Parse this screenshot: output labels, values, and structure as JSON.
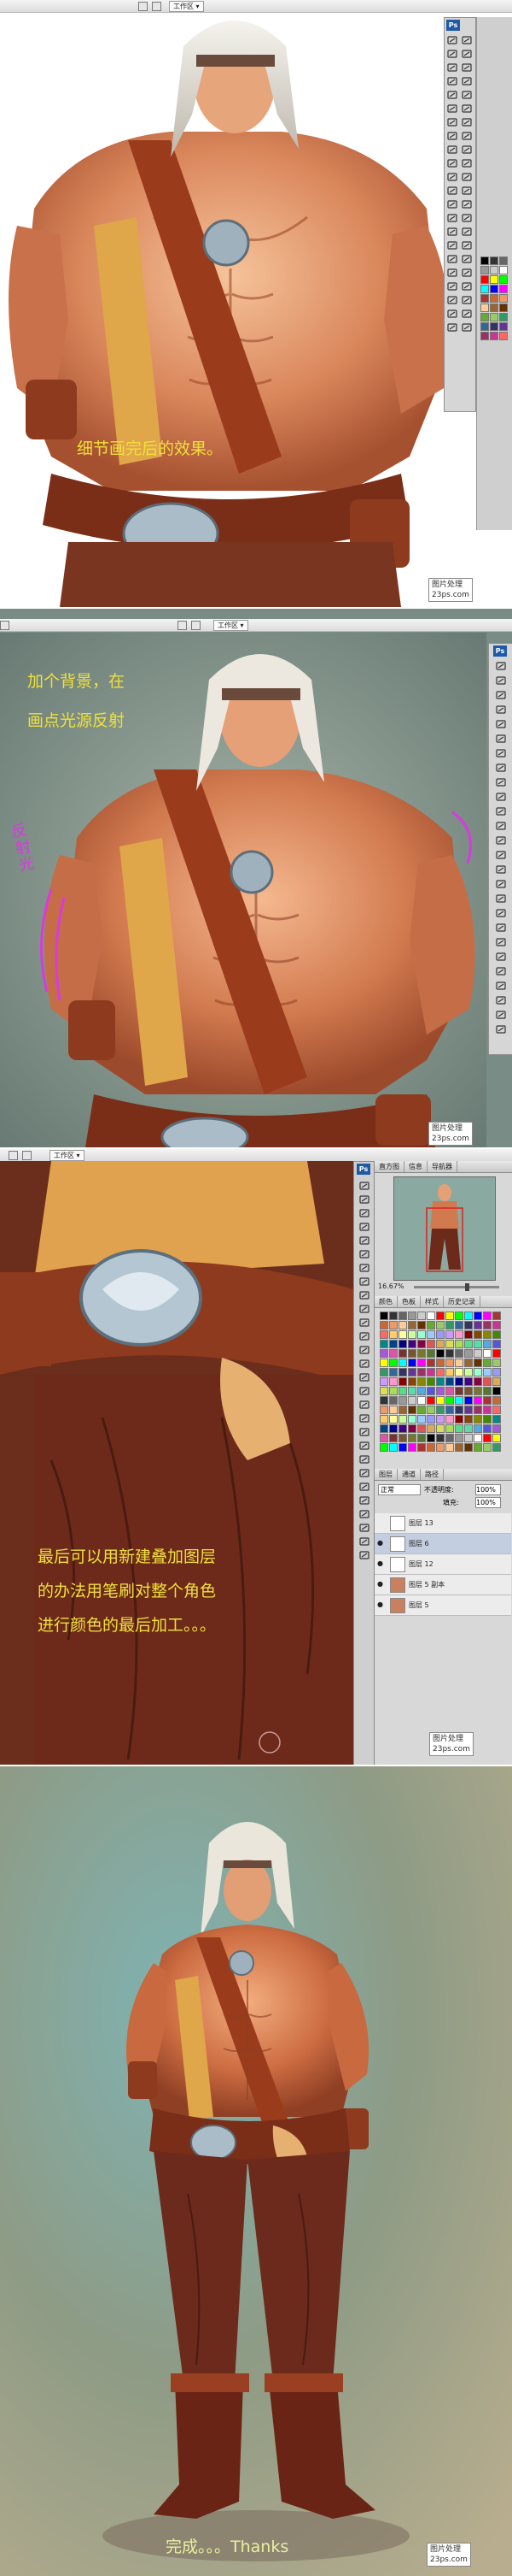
{
  "panel1": {
    "workspace_label": "工作区 ▾",
    "caption": "细节画完后的效果。",
    "watermark_line1": "图片处理",
    "watermark_line2": "23ps.com"
  },
  "panel2": {
    "workspace_label": "工作区 ▾",
    "caption_line1": "加个背景，在",
    "caption_line2": "画点光源反射",
    "annotation": "反射光",
    "watermark_line1": "图片处理",
    "watermark_line2": "23ps.com"
  },
  "panel3": {
    "workspace_label": "工作区 ▾",
    "zoom_readout": "16.67%",
    "tabs_top": [
      "直方图",
      "信息",
      "导航器"
    ],
    "tabs_mid": [
      "颜色",
      "色板",
      "样式",
      "历史记录"
    ],
    "tabs_layers": [
      "图层",
      "通道",
      "路径"
    ],
    "blend_mode": "正常",
    "opacity_label": "不透明度:",
    "opacity_value": "100%",
    "fill_label": "填充:",
    "fill_value": "100%",
    "layers": [
      "图层 13",
      "图层 6",
      "图层 12",
      "图层 5 副本",
      "图层 5"
    ],
    "caption_line1": "最后可以用新建叠加图层",
    "caption_line2": "的办法用笔刷对整个角色",
    "caption_line3": "进行颜色的最后加工。。。",
    "watermark_line1": "图片处理",
    "watermark_line2": "23ps.com"
  },
  "panel4": {
    "caption": "完成。。。Thanks",
    "watermark_line1": "图片处理",
    "watermark_line2": "23ps.com"
  },
  "colors": {
    "caption_yellow": "#f0e03a",
    "caption_pale": "#e8f0a0",
    "annotation_magenta": "#d83ae0",
    "ps_blue": "#1f5aa6"
  }
}
